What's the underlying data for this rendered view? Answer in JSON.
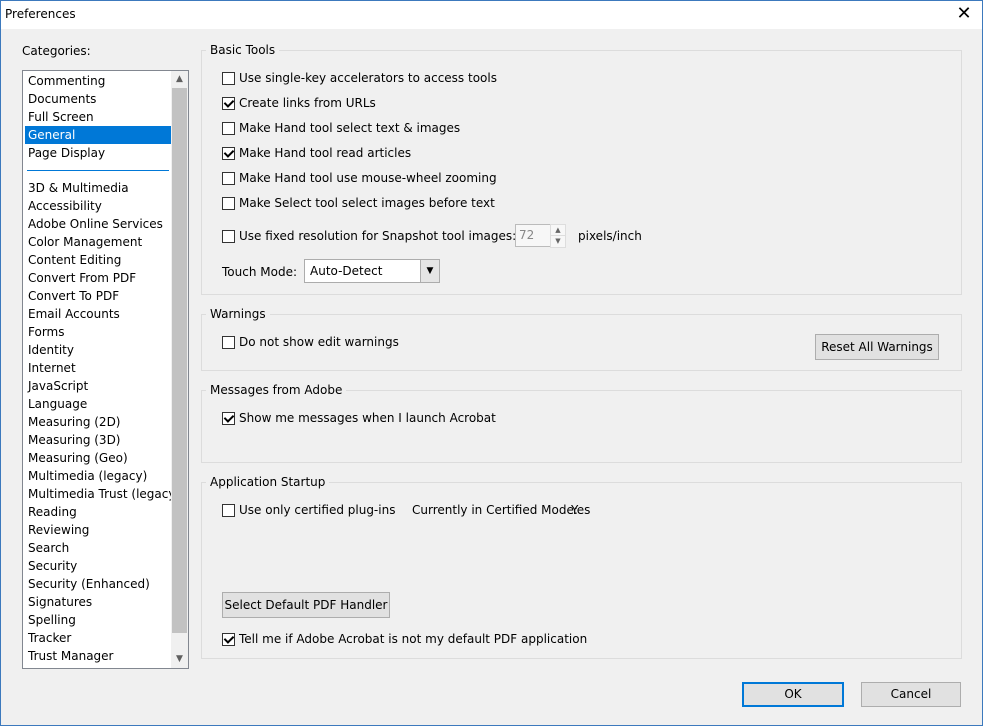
{
  "window": {
    "title": "Preferences",
    "close_glyph": "✕"
  },
  "categories": {
    "label": "Categories:",
    "group1": [
      "Commenting",
      "Documents",
      "Full Screen",
      "General",
      "Page Display"
    ],
    "group2": [
      "3D & Multimedia",
      "Accessibility",
      "Adobe Online Services",
      "Color Management",
      "Content Editing",
      "Convert From PDF",
      "Convert To PDF",
      "Email Accounts",
      "Forms",
      "Identity",
      "Internet",
      "JavaScript",
      "Language",
      "Measuring (2D)",
      "Measuring (3D)",
      "Measuring (Geo)",
      "Multimedia (legacy)",
      "Multimedia Trust (legacy)",
      "Reading",
      "Reviewing",
      "Search",
      "Security",
      "Security (Enhanced)",
      "Signatures",
      "Spelling",
      "Tracker",
      "Trust Manager"
    ],
    "selected": "General"
  },
  "basic_tools": {
    "title": "Basic Tools",
    "options": [
      {
        "label": "Use single-key accelerators to access tools",
        "checked": false
      },
      {
        "label": "Create links from URLs",
        "checked": true
      },
      {
        "label": "Make Hand tool select text & images",
        "checked": false
      },
      {
        "label": "Make Hand tool read articles",
        "checked": true
      },
      {
        "label": "Make Hand tool use mouse-wheel zooming",
        "checked": false
      },
      {
        "label": "Make Select tool select images before text",
        "checked": false
      }
    ],
    "snapshot": {
      "label": "Use fixed resolution for Snapshot tool images:",
      "checked": false,
      "value": "72",
      "unit": "pixels/inch"
    },
    "touch_mode": {
      "label": "Touch Mode:",
      "value": "Auto-Detect"
    }
  },
  "warnings": {
    "title": "Warnings",
    "option": {
      "label": "Do not show edit warnings",
      "checked": false
    },
    "reset_label": "Reset All Warnings"
  },
  "messages": {
    "title": "Messages from Adobe",
    "option": {
      "label": "Show me messages when I launch Acrobat",
      "checked": true
    }
  },
  "startup": {
    "title": "Application Startup",
    "certified": {
      "label": "Use only certified plug-ins",
      "checked": false
    },
    "certified_mode_label": "Currently in Certified Mode:",
    "certified_mode_value": "Yes",
    "default_handler_label": "Select Default PDF Handler",
    "default_check": {
      "label": "Tell me if Adobe Acrobat is not my default PDF application",
      "checked": true
    }
  },
  "footer": {
    "ok_label": "OK",
    "cancel_label": "Cancel"
  }
}
